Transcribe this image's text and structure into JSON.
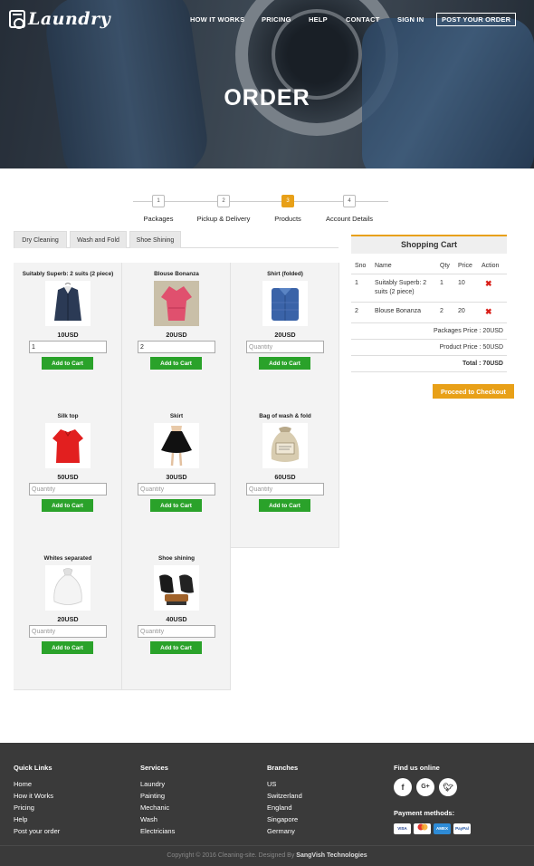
{
  "brand": {
    "name": "Laundry"
  },
  "nav": {
    "how": "HOW IT WORKS",
    "pricing": "PRICING",
    "help": "HELP",
    "contact": "CONTACT",
    "signin": "SIGN IN",
    "post": "POST YOUR ORDER"
  },
  "hero": {
    "title": "ORDER"
  },
  "steps": [
    {
      "num": "1",
      "label": "Packages"
    },
    {
      "num": "2",
      "label": "Pickup & Delivery"
    },
    {
      "num": "3",
      "label": "Products"
    },
    {
      "num": "4",
      "label": "Account Details"
    }
  ],
  "tabs": [
    "Dry Cleaning",
    "Wash and Fold",
    "Shoe Shining"
  ],
  "add_label": "Add to Cart",
  "qty_placeholder": "Quantity",
  "products": [
    {
      "name": "Suitably Superb: 2 suits (2 piece)",
      "price": "10USD",
      "qty": "1",
      "icon": "suit-icon"
    },
    {
      "name": "Blouse Bonanza",
      "price": "20USD",
      "qty": "2",
      "icon": "blouse-icon"
    },
    {
      "name": "Shirt (folded)",
      "price": "20USD",
      "qty": "",
      "icon": "shirt-icon"
    },
    {
      "name": "Silk top",
      "price": "50USD",
      "qty": "",
      "icon": "silk-top-icon"
    },
    {
      "name": "Skirt",
      "price": "30USD",
      "qty": "",
      "icon": "skirt-icon"
    },
    {
      "name": "Bag of wash & fold",
      "price": "60USD",
      "qty": "",
      "icon": "laundry-bag-icon"
    },
    {
      "name": "Whites separated",
      "price": "20USD",
      "qty": "",
      "icon": "white-bag-icon"
    },
    {
      "name": "Shoe shining",
      "price": "40USD",
      "qty": "",
      "icon": "shoes-icon"
    }
  ],
  "cart": {
    "title": "Shopping Cart",
    "headers": [
      "Sno",
      "Name",
      "Qty",
      "Price",
      "Action"
    ],
    "rows": [
      {
        "sno": "1",
        "name": "Suitably Superb: 2 suits (2 piece)",
        "qty": "1",
        "price": "10"
      },
      {
        "sno": "2",
        "name": "Blouse Bonanza",
        "qty": "2",
        "price": "20"
      }
    ],
    "packages_price": "Packages Price : 20USD",
    "product_price": "Product Price : 50USD",
    "total": "Total : 70USD",
    "checkout": "Proceed to Checkout"
  },
  "footer": {
    "quick": {
      "title": "Quick Links",
      "links": [
        "Home",
        "How it Works",
        "Pricing",
        "Help",
        "Post your order"
      ]
    },
    "services": {
      "title": "Services",
      "links": [
        "Laundry",
        "Painting",
        "Mechanic",
        "Wash",
        "Electricians"
      ]
    },
    "branches": {
      "title": "Branches",
      "links": [
        "US",
        "Switzerland",
        "England",
        "Singapore",
        "Germany"
      ]
    },
    "social_title": "Find us online",
    "payment_title": "Payment methods:",
    "copyright": "Copyright © 2016 Cleaning-site. Designed By",
    "designer": "SangVish Technologies"
  },
  "colors": {
    "accent": "#e8a018",
    "add": "#2aa22a",
    "footer": "#3a3a3a",
    "remove": "#d91e18"
  }
}
